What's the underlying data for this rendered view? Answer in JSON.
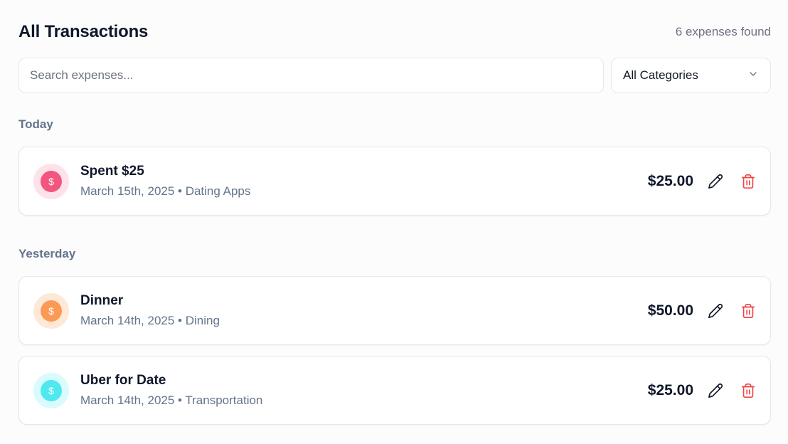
{
  "header": {
    "title": "All Transactions",
    "count": "6 expenses found"
  },
  "filters": {
    "search_placeholder": "Search expenses...",
    "category_selected": "All Categories"
  },
  "groups": [
    {
      "label": "Today",
      "items": [
        {
          "name": "Spent $25",
          "meta": "March 15th, 2025 • Dating Apps",
          "amount": "$25.00",
          "icon_symbol": "$",
          "icon_bg": "#fde2ea",
          "icon_color": "#f2567e"
        }
      ]
    },
    {
      "label": "Yesterday",
      "items": [
        {
          "name": "Dinner",
          "meta": "March 14th, 2025 • Dining",
          "amount": "$50.00",
          "icon_symbol": "$",
          "icon_bg": "#fee8d6",
          "icon_color": "#fb9a55"
        },
        {
          "name": "Uber for Date",
          "meta": "March 14th, 2025 • Transportation",
          "amount": "$25.00",
          "icon_symbol": "$",
          "icon_bg": "#d9fbfd",
          "icon_color": "#4fe8f0"
        }
      ]
    }
  ],
  "colors": {
    "delete": "#ef4444",
    "edit": "#111827"
  }
}
